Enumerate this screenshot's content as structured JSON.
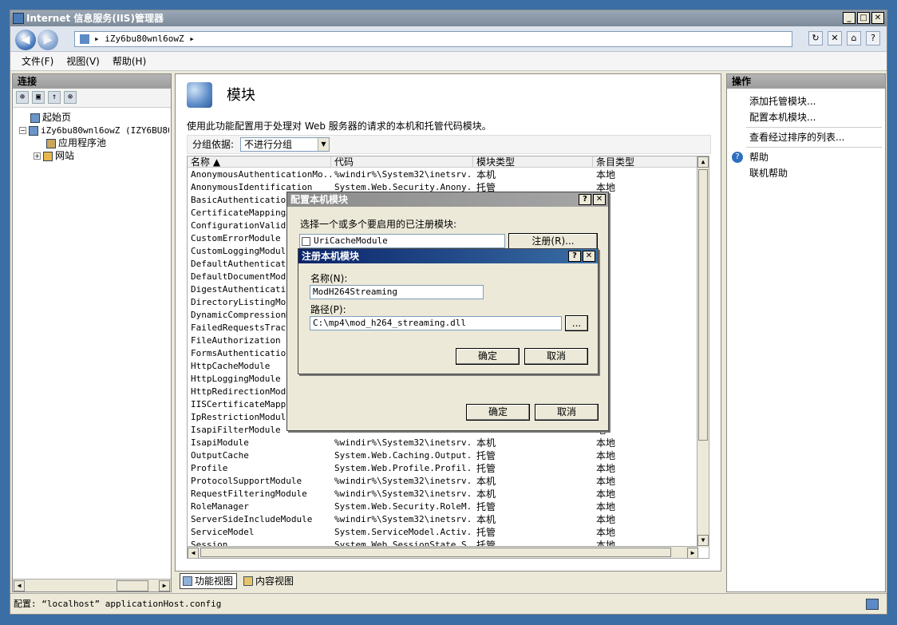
{
  "window": {
    "title": "Internet 信息服务(IIS)管理器"
  },
  "navbar": {
    "breadcrumb": "iZy6bu80wnl6owZ",
    "sep": "▸"
  },
  "menu": [
    "文件(F)",
    "视图(V)",
    "帮助(H)"
  ],
  "connections": {
    "header": "连接",
    "tree": [
      {
        "label": "起始页"
      },
      {
        "label": "iZy6bu80wnl6owZ (IZY6BU80W"
      },
      {
        "label": "应用程序池"
      },
      {
        "label": "网站"
      }
    ]
  },
  "feature": {
    "title": "模块",
    "description": "使用此功能配置用于处理对 Web 服务器的请求的本机和托管代码模块。",
    "group_label": "分组依据:",
    "group_value": "不进行分组"
  },
  "grid": {
    "columns": [
      "名称",
      "代码",
      "模块类型",
      "条目类型"
    ],
    "rows": [
      [
        "AnonymousAuthenticationMo...",
        "%windir%\\System32\\inetsrv...",
        "本机",
        "本地"
      ],
      [
        "AnonymousIdentification",
        "System.Web.Security.Anony...",
        "托管",
        "本地"
      ],
      [
        "BasicAuthenticationModule",
        "",
        "",
        "地"
      ],
      [
        "CertificateMappingAuthent",
        "",
        "",
        "地"
      ],
      [
        "ConfigurationValidationMo",
        "",
        "",
        "地"
      ],
      [
        "CustomErrorModule",
        "",
        "",
        "地"
      ],
      [
        "CustomLoggingModule",
        "",
        "",
        "地"
      ],
      [
        "DefaultAuthenticationModu",
        "",
        "",
        "地"
      ],
      [
        "DefaultDocumentModule",
        "",
        "",
        "地"
      ],
      [
        "DigestAuthenticationModul",
        "",
        "",
        "地"
      ],
      [
        "DirectoryListingModule",
        "",
        "",
        "地"
      ],
      [
        "DynamicCompressionModule",
        "",
        "",
        "地"
      ],
      [
        "FailedRequestsTracingModu",
        "",
        "",
        "地"
      ],
      [
        "FileAuthorization",
        "",
        "",
        "地"
      ],
      [
        "FormsAuthentication",
        "",
        "",
        "地"
      ],
      [
        "HttpCacheModule",
        "",
        "",
        "地"
      ],
      [
        "HttpLoggingModule",
        "",
        "",
        "地"
      ],
      [
        "HttpRedirectionModule",
        "",
        "",
        "地"
      ],
      [
        "IISCertificateMappingAuth",
        "",
        "",
        "地"
      ],
      [
        "IpRestrictionModule",
        "",
        "",
        "地"
      ],
      [
        "IsapiFilterModule",
        "",
        "",
        "地"
      ],
      [
        "IsapiModule",
        "%windir%\\System32\\inetsrv...",
        "本机",
        "本地"
      ],
      [
        "OutputCache",
        "System.Web.Caching.Output...",
        "托管",
        "本地"
      ],
      [
        "Profile",
        "System.Web.Profile.Profil...",
        "托管",
        "本地"
      ],
      [
        "ProtocolSupportModule",
        "%windir%\\System32\\inetsrv...",
        "本机",
        "本地"
      ],
      [
        "RequestFilteringModule",
        "%windir%\\System32\\inetsrv...",
        "本机",
        "本地"
      ],
      [
        "RoleManager",
        "System.Web.Security.RoleM...",
        "托管",
        "本地"
      ],
      [
        "ServerSideIncludeModule",
        "%windir%\\System32\\inetsrv...",
        "本机",
        "本地"
      ],
      [
        "ServiceModel",
        "System.ServiceModel.Activ...",
        "托管",
        "本地"
      ],
      [
        "Session",
        "System.Web.SessionState.S...",
        "托管",
        "本地"
      ]
    ]
  },
  "view_tabs": {
    "features": "功能视图",
    "content": "内容视图"
  },
  "actions": {
    "header": "操作",
    "items": [
      "添加托管模块...",
      "配置本机模块...",
      "查看经过排序的列表..."
    ],
    "help": "帮助",
    "online_help": "联机帮助"
  },
  "status": {
    "text": "配置: “localhost” applicationHost.config"
  },
  "configure_dialog": {
    "title": "配置本机模块",
    "prompt": "选择一个或多个要启用的已注册模块:",
    "module": "UriCacheModule",
    "register": "注册(R)...",
    "ok": "确定",
    "cancel": "取消"
  },
  "register_dialog": {
    "title": "注册本机模块",
    "name_label": "名称(N):",
    "name_value": "ModH264Streaming",
    "path_label": "路径(P):",
    "path_value": "C:\\mp4\\mod_h264_streaming.dll",
    "browse": "...",
    "ok": "确定",
    "cancel": "取消"
  },
  "glyphs": {
    "help": "?",
    "close": "✕",
    "minimize": "_",
    "maximize": "□"
  }
}
